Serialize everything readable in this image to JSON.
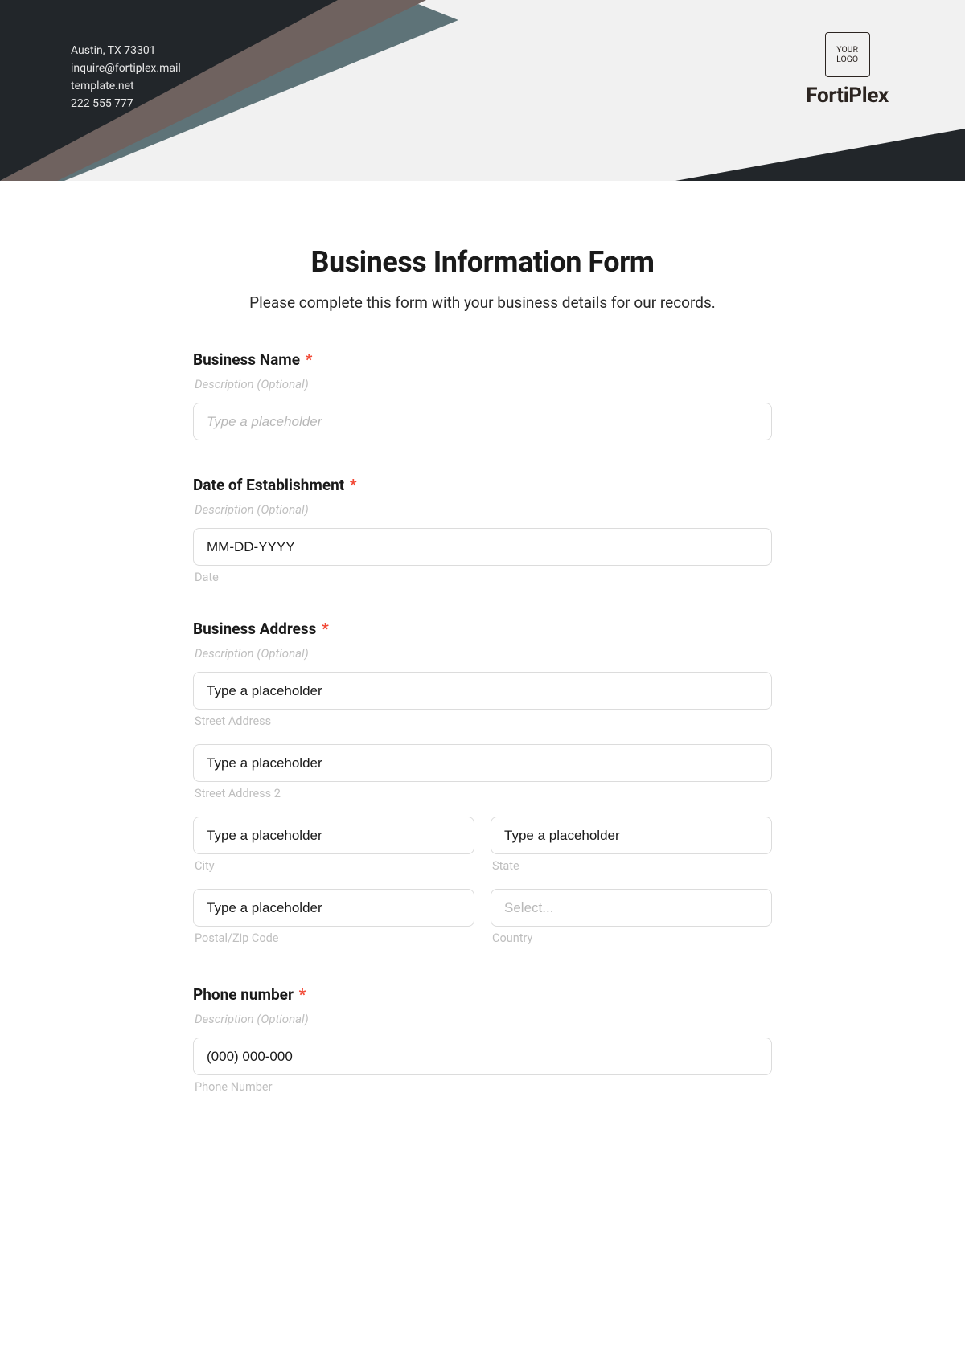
{
  "header": {
    "info_lines": [
      "Austin, TX 73301",
      "inquire@fortiplex.mail",
      "template.net",
      "222 555 777"
    ],
    "logo_label": "YOUR LOGO",
    "brand": "FortiPlex"
  },
  "form": {
    "title": "Business Information Form",
    "subtitle": "Please complete this form with your business details for our records.",
    "desc_placeholder": "Description (Optional)",
    "required_mark": "*",
    "sections": {
      "business_name": {
        "label": "Business Name",
        "placeholder": "Type a placeholder"
      },
      "date_est": {
        "label": "Date of Establishment",
        "placeholder": "MM-DD-YYYY",
        "sublabel": "Date"
      },
      "address": {
        "label": "Business Address",
        "street1": {
          "placeholder": "Type a placeholder",
          "sublabel": "Street Address"
        },
        "street2": {
          "placeholder": "Type a placeholder",
          "sublabel": "Street Address 2"
        },
        "city": {
          "placeholder": "Type a placeholder",
          "sublabel": "City"
        },
        "state": {
          "placeholder": "Type a placeholder",
          "sublabel": "State"
        },
        "postal": {
          "placeholder": "Type a placeholder",
          "sublabel": "Postal/Zip Code"
        },
        "country": {
          "placeholder": "Select...",
          "sublabel": "Country"
        }
      },
      "phone": {
        "label": "Phone number",
        "placeholder": "(000) 000-000",
        "sublabel": "Phone Number"
      }
    }
  }
}
